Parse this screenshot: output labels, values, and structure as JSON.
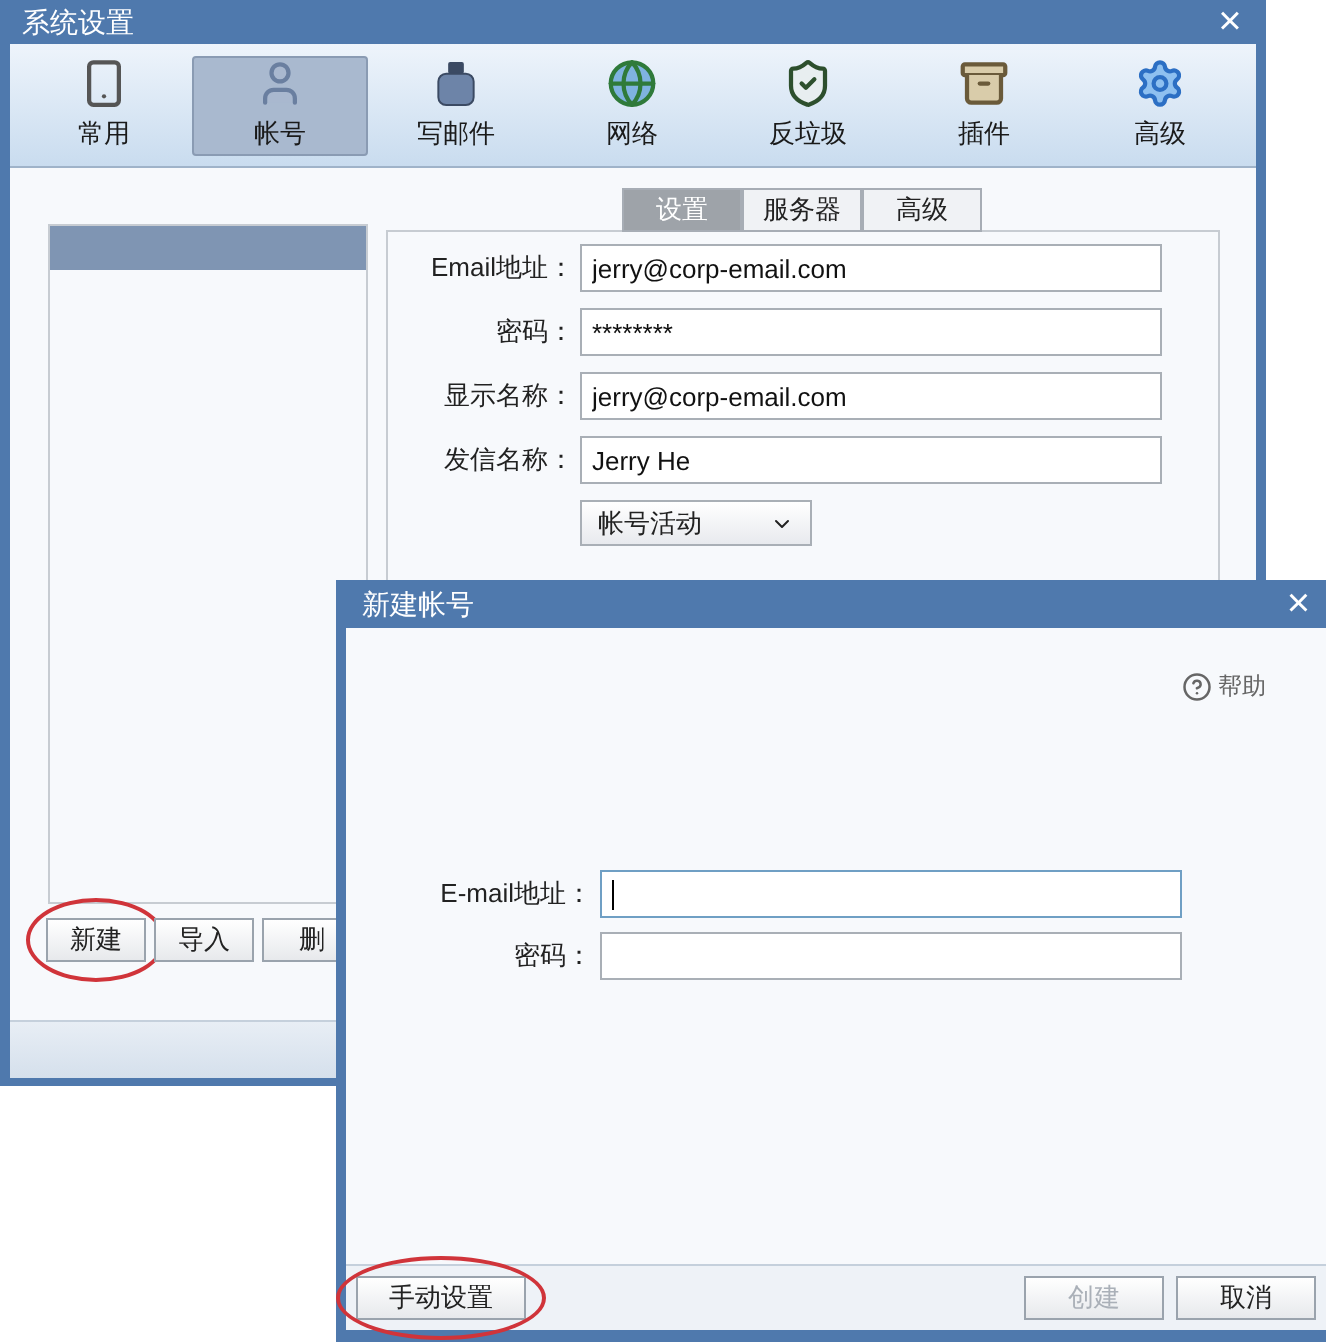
{
  "main_window": {
    "title": "系统设置",
    "close": "×",
    "toolbar": [
      {
        "label": "常用",
        "selected": false
      },
      {
        "label": "帐号",
        "selected": true
      },
      {
        "label": "写邮件",
        "selected": false
      },
      {
        "label": "网络",
        "selected": false
      },
      {
        "label": "反垃圾",
        "selected": false
      },
      {
        "label": "插件",
        "selected": false
      },
      {
        "label": "高级",
        "selected": false
      }
    ],
    "accounts": [
      {
        "selected": true
      }
    ],
    "account_buttons": [
      {
        "label": "新建",
        "highlighted": true
      },
      {
        "label": "导入",
        "highlighted": false
      },
      {
        "label": "删",
        "highlighted": false
      }
    ],
    "tabs": [
      {
        "label": "设置",
        "selected": true
      },
      {
        "label": "服务器",
        "selected": false
      },
      {
        "label": "高级",
        "selected": false
      }
    ],
    "fields": [
      {
        "label": "Email地址：",
        "value": "jerry@corp-email.com"
      },
      {
        "label": "密码：",
        "value": "********"
      },
      {
        "label": "显示名称：",
        "value": "jerry@corp-email.com"
      },
      {
        "label": "发信名称：",
        "value": "Jerry He"
      }
    ],
    "dropdown": {
      "value": "帐号活动"
    }
  },
  "dialog": {
    "title": "新建帐号",
    "close": "×",
    "help": "帮助",
    "fields": [
      {
        "label": "E-mail地址：",
        "focused": true
      },
      {
        "label": "密码：",
        "focused": false
      }
    ],
    "buttons": [
      {
        "label": "手动设置",
        "disabled": false,
        "highlighted": true
      },
      {
        "label": "创建",
        "disabled": true,
        "highlighted": false
      },
      {
        "label": "取消",
        "disabled": false,
        "highlighted": false
      }
    ]
  }
}
